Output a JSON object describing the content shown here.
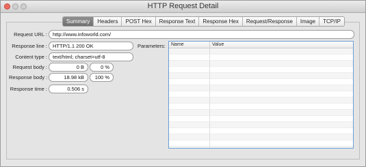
{
  "window": {
    "title": "HTTP Request Detail"
  },
  "tabs": [
    {
      "label": "Summary",
      "active": true
    },
    {
      "label": "Headers"
    },
    {
      "label": "POST Hex"
    },
    {
      "label": "Response Text"
    },
    {
      "label": "Response Hex"
    },
    {
      "label": "Request/Response"
    },
    {
      "label": "Image"
    },
    {
      "label": "TCP/IP"
    }
  ],
  "summary": {
    "request_url_label": "Request URL :",
    "request_url": "http://www.infoworld.com/",
    "response_line_label": "Response  line :",
    "response_line": "HTTP/1.1 200 OK",
    "content_type_label": "Content type :",
    "content_type": "text/html; charset=utf-8",
    "request_body_label": "Request  body :",
    "request_body_size": "0 B",
    "request_body_pct": "0 %",
    "response_body_label": "Response body :",
    "response_body_size": "18.98 kB",
    "response_body_pct": "100 %",
    "response_time_label": "Response time :",
    "response_time": "0.506 s",
    "parameters_label": "Parameters:"
  },
  "parameters_table": {
    "columns": [
      "Name",
      "Value"
    ],
    "rows": []
  }
}
